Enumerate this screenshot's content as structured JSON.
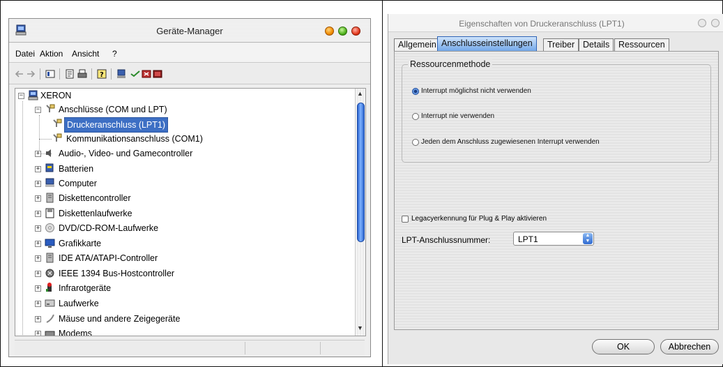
{
  "device_manager": {
    "title": "Geräte-Manager",
    "menu": [
      "Datei",
      "Aktion",
      "Ansicht",
      "?"
    ],
    "tree": {
      "root": "XERON",
      "ports_category": "Anschlüsse (COM und LPT)",
      "ports_children": [
        "Druckeranschluss (LPT1)",
        "Kommunikationsanschluss (COM1)"
      ],
      "categories": [
        "Audio-, Video- und Gamecontroller",
        "Batterien",
        "Computer",
        "Diskettencontroller",
        "Diskettenlaufwerke",
        "DVD/CD-ROM-Laufwerke",
        "Grafikkarte",
        "IDE ATA/ATAPI-Controller",
        "IEEE 1394 Bus-Hostcontroller",
        "Infrarotgeräte",
        "Laufwerke",
        "Mäuse und andere Zeigegeräte",
        "Modems"
      ]
    }
  },
  "properties": {
    "title": "Eigenschaften von Druckeranschluss (LPT1)",
    "tabs": [
      "Allgemein",
      "Anschlusseinstellungen",
      "Treiber",
      "Details",
      "Ressourcen"
    ],
    "active_tab": "Anschlusseinstellungen",
    "group_title": "Ressourcenmethode",
    "radio_options": [
      "Interrupt möglichst nicht verwenden",
      "Interrupt nie verwenden",
      "Jeden dem Anschluss zugewiesenen Interrupt verwenden"
    ],
    "radio_selected_index": 0,
    "legacy_checkbox": {
      "label": "Legacyerkennung für Plug & Play aktivieren",
      "checked": false
    },
    "lpt_label": "LPT-Anschlussnummer:",
    "lpt_value": "LPT1",
    "ok_label": "OK",
    "cancel_label": "Abbrechen"
  },
  "colors": {
    "selection": "#3d6fc4",
    "active_tab": "#6ea4e8",
    "scroll_thumb": "#2a63cf"
  }
}
